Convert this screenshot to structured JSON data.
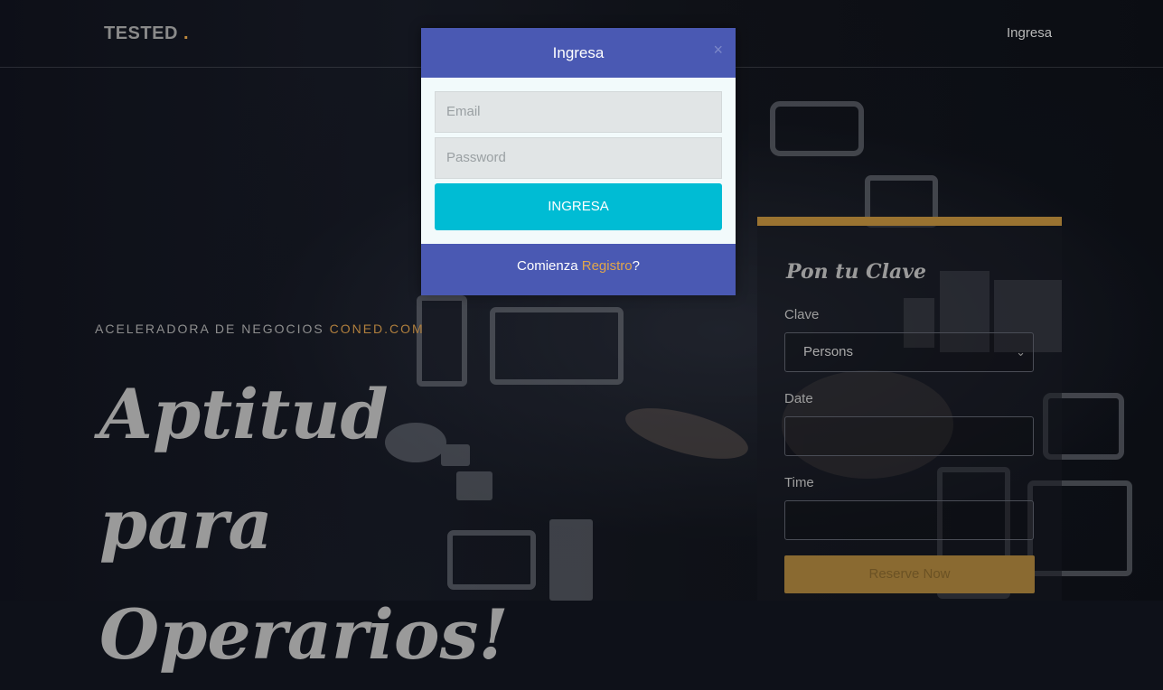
{
  "header": {
    "logo_text": "TESTED",
    "logo_dot": ".",
    "nav_login": "Ingresa"
  },
  "hero": {
    "tag_prefix": "ACELERADORA DE NEGOCIOS",
    "tag_brand": "CONED.COM",
    "title_line1": "Aptitud para",
    "title_line2": "Operarios!"
  },
  "reservation": {
    "title": "Pon tu Clave",
    "clave_label": "Clave",
    "clave_value": "Persons",
    "date_label": "Date",
    "time_label": "Time",
    "submit_label": "Reserve Now"
  },
  "modal": {
    "title": "Ingresa",
    "close_symbol": "×",
    "email_placeholder": "Email",
    "password_placeholder": "Password",
    "submit_label": "INGRESA",
    "footer_text": "Comienza",
    "footer_link": "Registro",
    "footer_suffix": "?"
  },
  "colors": {
    "modal_header": "#4a59b3",
    "modal_submit": "#00bcd4",
    "accent_gold": "#9a7331",
    "link_orange": "#e0a54b"
  }
}
